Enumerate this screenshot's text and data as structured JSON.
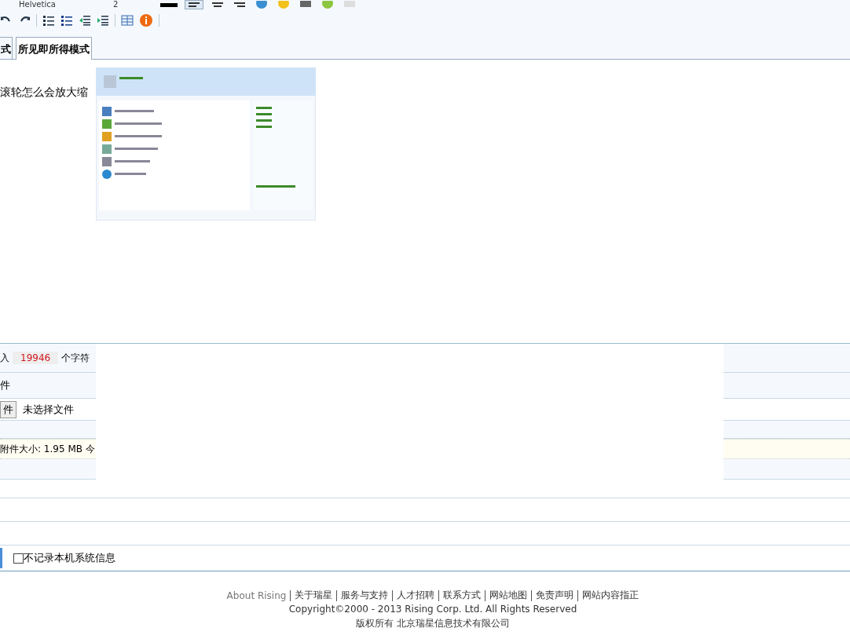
{
  "toolbar": {
    "font": "Helvetica",
    "size": "2"
  },
  "tabs": [
    {
      "label": "式",
      "selected": false
    },
    {
      "label": "所见即所得模式",
      "selected": true
    }
  ],
  "editor": {
    "text": "滚轮怎么会放大缩"
  },
  "char_count": {
    "prefix": "入",
    "count": "19946",
    "suffix": "个字符"
  },
  "attachments": {
    "heading": "件",
    "file_button": "件",
    "file_status": "未选择文件",
    "info": "附件大小: 1.95 MB  今"
  },
  "options": [
    {
      "label": "不记录本机系统信息",
      "checked": false
    }
  ],
  "footer": {
    "links": [
      "About Rising",
      "关于瑞星",
      "服务与支持",
      "人才招聘",
      "联系方式",
      "网站地图",
      "免责声明",
      "网站内容指正"
    ],
    "copyright": "Copyright©2000 - 2013 Rising Corp. Ltd.  All Rights Reserved",
    "company": "版权所有 北京瑞星信息技术有限公司"
  }
}
